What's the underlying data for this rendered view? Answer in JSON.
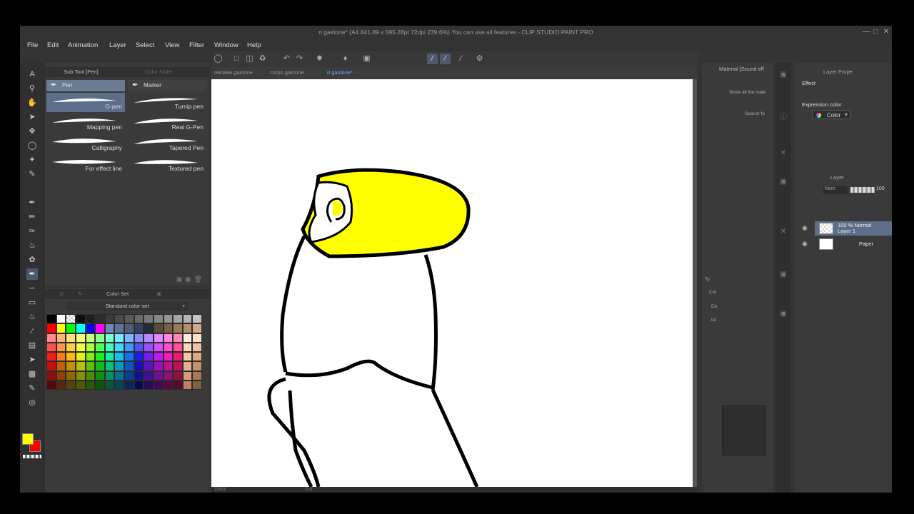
{
  "window": {
    "title": "ri gastone* (A4 841.89 x 595.28pt 72dpi 239.6%)  You can use all features - CLIP STUDIO PAINT PRO",
    "minimize_icon": "minimize-icon",
    "maximize_icon": "maximize-icon",
    "close_icon": "close-icon"
  },
  "menu": [
    "File",
    "Edit",
    "Animation",
    "Layer",
    "Select",
    "View",
    "Filter",
    "Window",
    "Help"
  ],
  "subtool_panel": {
    "tab_label": "Sub Tool [Pen]",
    "tab2_label": "Color Slider",
    "groups": [
      "Pen",
      "Marker"
    ],
    "brushes": [
      {
        "name": "G-pen",
        "active": true
      },
      {
        "name": "Turnip pen",
        "active": false
      },
      {
        "name": "Mapping pen",
        "active": false
      },
      {
        "name": "Real G-Pen",
        "active": false
      },
      {
        "name": "Calligraphy",
        "active": false
      },
      {
        "name": "Tapered Pen",
        "active": false
      },
      {
        "name": "For effect line",
        "active": false
      },
      {
        "name": "Textured pen",
        "active": false
      }
    ]
  },
  "color_set_panel": {
    "tab_label": "Color Set",
    "set_name": "Standard color set",
    "swatches": [
      "#000000",
      "#ffffff",
      "transparent",
      "#0f0f0f",
      "#1e1e1e",
      "#2d2d2d",
      "#3c3c3c",
      "#4b4b4b",
      "#5a5a5a",
      "#696969",
      "#787878",
      "#878787",
      "#969696",
      "#a5a5a5",
      "#b4b4b4",
      "#c3c3c3",
      "#ff0000",
      "#ffff00",
      "#00ff00",
      "#00ffff",
      "#0000ff",
      "#ff00ff",
      "#6d8ab0",
      "#5a7598",
      "#4b6078",
      "#334060",
      "#202a3a",
      "#5a4a3a",
      "#7a6048",
      "#9a7a5a",
      "#b59070",
      "#d0aa8a",
      "#ff8a8a",
      "#ffb57a",
      "#ffe07a",
      "#faff7a",
      "#c8ff7a",
      "#8aff8a",
      "#7affd0",
      "#7ae6ff",
      "#7ab6ff",
      "#8a8aff",
      "#b58aff",
      "#e08aff",
      "#ff8ae0",
      "#ff8ab5",
      "#fff0e0",
      "#ffe0c8",
      "#ff5050",
      "#ff9640",
      "#ffd040",
      "#f4ff40",
      "#a8ff40",
      "#50ff50",
      "#40ffb8",
      "#40d8ff",
      "#4098ff",
      "#5050ff",
      "#9850ff",
      "#d050ff",
      "#ff50d0",
      "#ff5098",
      "#ffd8b8",
      "#f0c0a0",
      "#ff1a1a",
      "#ff7a10",
      "#ffb810",
      "#e8f010",
      "#80f010",
      "#1af01a",
      "#10f0a0",
      "#10c0f0",
      "#1070f0",
      "#1a1af0",
      "#7a1af0",
      "#c01af0",
      "#f01ac0",
      "#f01a70",
      "#f8c8a0",
      "#e0a880",
      "#c81010",
      "#c85c08",
      "#c89008",
      "#b8c008",
      "#60c008",
      "#10c010",
      "#08c080",
      "#0898c0",
      "#0858c0",
      "#1010c0",
      "#5c10c0",
      "#9810c0",
      "#c01098",
      "#c01058",
      "#e8b090",
      "#c89070",
      "#901010",
      "#904008",
      "#906808",
      "#889008",
      "#489008",
      "#109010",
      "#089060",
      "#087090",
      "#084090",
      "#101090",
      "#401090",
      "#701090",
      "#901070",
      "#901040",
      "#d89a78",
      "#a87858",
      "#580808",
      "#582808",
      "#584008",
      "#505808",
      "#285808",
      "#085808",
      "#085838",
      "#084458",
      "#082858",
      "#080858",
      "#280858",
      "#440858",
      "#580844",
      "#580828",
      "#c08060",
      "#806040"
    ]
  },
  "document_tabs": [
    {
      "label": "remake gastone",
      "active": false
    },
    {
      "label": "corpo gastone",
      "active": false
    },
    {
      "label": "ri gastone*",
      "active": true
    }
  ],
  "canvas": {
    "zoom": "239.6",
    "angle": "0.0",
    "drawing_colors": {
      "line": "#000000",
      "fill": "#ffff00"
    }
  },
  "material_panel": {
    "tab_label": "Material [Sound eff",
    "show_all": "Show all the mate",
    "search": "Search fo",
    "type_label": "Ty",
    "buttons": [
      "Cre",
      "Do",
      "Ad"
    ]
  },
  "layer_property": {
    "title": "Layer Prope",
    "effect_label": "Effect",
    "expression_label": "Expression color",
    "expression_value": "Color"
  },
  "layer_panel": {
    "title": "Layer",
    "blend_mode": "Nom",
    "opacity": "100",
    "layers": [
      {
        "line1": "100 % Normal",
        "line2": "Layer 1",
        "active": true
      },
      {
        "line1": "Paper",
        "line2": "",
        "active": false
      }
    ]
  }
}
